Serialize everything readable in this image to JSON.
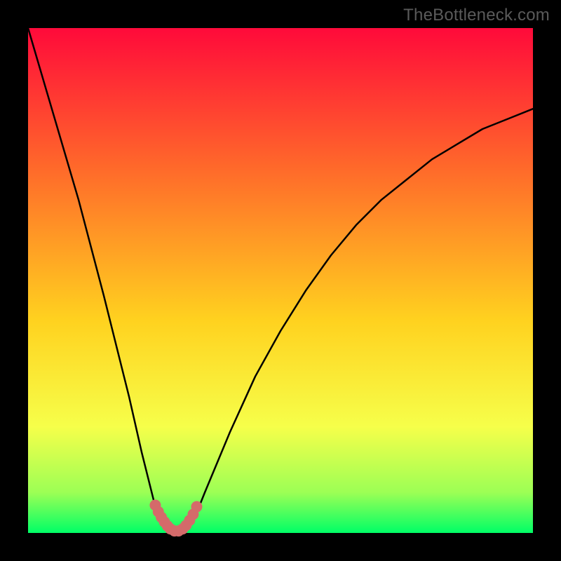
{
  "watermark": "TheBottleneck.com",
  "colors": {
    "frame": "#000000",
    "gradient_top": "#ff0a3a",
    "gradient_mid1": "#ff6a2a",
    "gradient_mid2": "#ffd21f",
    "gradient_mid3": "#f6ff4a",
    "gradient_mid4": "#9cff55",
    "gradient_bottom": "#00ff66",
    "curve": "#000000",
    "marker": "#d46a6a"
  },
  "chart_data": {
    "type": "line",
    "x": [
      0.0,
      0.05,
      0.1,
      0.15,
      0.2,
      0.225,
      0.25,
      0.275,
      0.28,
      0.29,
      0.3,
      0.31,
      0.32,
      0.33,
      0.35,
      0.4,
      0.45,
      0.5,
      0.55,
      0.6,
      0.65,
      0.7,
      0.75,
      0.8,
      0.85,
      0.9,
      0.95,
      1.0
    ],
    "values": [
      1.0,
      0.83,
      0.66,
      0.47,
      0.27,
      0.16,
      0.06,
      0.015,
      0.005,
      0.0,
      0.0,
      0.005,
      0.015,
      0.03,
      0.08,
      0.2,
      0.31,
      0.4,
      0.48,
      0.55,
      0.61,
      0.66,
      0.7,
      0.74,
      0.77,
      0.8,
      0.82,
      0.84
    ],
    "series": [
      {
        "name": "bottleneck-curve",
        "x": [
          0.0,
          0.05,
          0.1,
          0.15,
          0.2,
          0.225,
          0.25,
          0.275,
          0.28,
          0.29,
          0.3,
          0.31,
          0.32,
          0.33,
          0.35,
          0.4,
          0.45,
          0.5,
          0.55,
          0.6,
          0.65,
          0.7,
          0.75,
          0.8,
          0.85,
          0.9,
          0.95,
          1.0
        ],
        "y": [
          1.0,
          0.83,
          0.66,
          0.47,
          0.27,
          0.16,
          0.06,
          0.015,
          0.005,
          0.0,
          0.0,
          0.005,
          0.015,
          0.03,
          0.08,
          0.2,
          0.31,
          0.4,
          0.48,
          0.55,
          0.61,
          0.66,
          0.7,
          0.74,
          0.77,
          0.8,
          0.82,
          0.84
        ]
      },
      {
        "name": "valley-markers",
        "x": [
          0.252,
          0.258,
          0.264,
          0.27,
          0.276,
          0.282,
          0.29,
          0.298,
          0.306,
          0.313,
          0.32,
          0.327,
          0.334
        ],
        "y": [
          0.055,
          0.042,
          0.031,
          0.022,
          0.014,
          0.008,
          0.004,
          0.004,
          0.008,
          0.015,
          0.025,
          0.037,
          0.052
        ]
      }
    ],
    "title": "",
    "xlabel": "",
    "ylabel": "",
    "xlim": [
      0,
      1
    ],
    "ylim": [
      0,
      1
    ],
    "grid": false,
    "legend": false
  }
}
